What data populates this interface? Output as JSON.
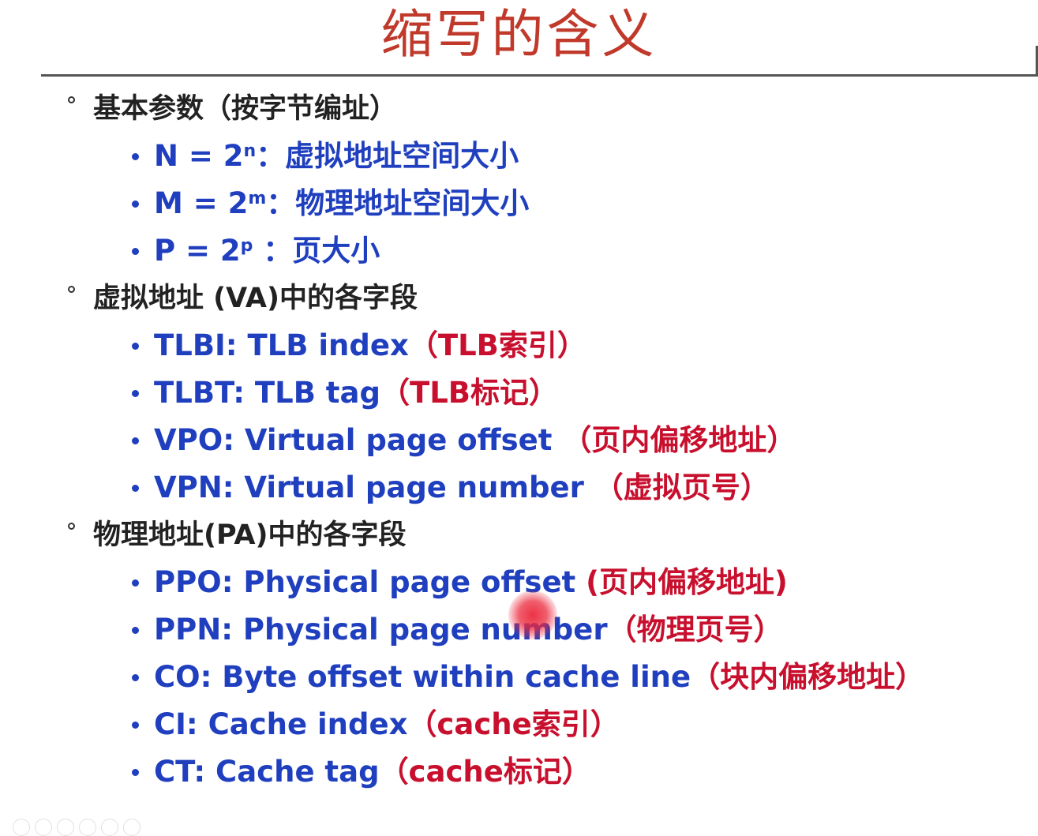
{
  "title": "缩写的含义",
  "sections": [
    {
      "heading": "基本参数（按字节编址）",
      "items": [
        {
          "pre": "N = 2",
          "sup": "n",
          "post": "：虚拟地址空间大小",
          "note": ""
        },
        {
          "pre": "M = 2",
          "sup": "m",
          "post": "：物理地址空间大小",
          "note": ""
        },
        {
          "pre": "P = 2",
          "sup": "p",
          "post": " ：页大小",
          "note": ""
        }
      ]
    },
    {
      "heading": "虚拟地址 (VA)中的各字段",
      "items": [
        {
          "text": "TLBI: TLB index",
          "note": "（TLB索引）"
        },
        {
          "text": "TLBT: TLB tag",
          "note": "（TLB标记）"
        },
        {
          "text": "VPO: Virtual page offset ",
          "note": "（页内偏移地址）"
        },
        {
          "text": "VPN: Virtual page number ",
          "note": "（虚拟页号）"
        }
      ]
    },
    {
      "heading": "物理地址(PA)中的各字段",
      "items": [
        {
          "text": "PPO: Physical page offset ",
          "note": "(页内偏移地址)"
        },
        {
          "text": "PPN: Physical page number",
          "note": "（物理页号）"
        },
        {
          "text": "CO: Byte offset within cache line",
          "note": "（块内偏移地址）"
        },
        {
          "text": "CI: Cache index",
          "note": "（cache索引）"
        },
        {
          "text": "CT: Cache tag",
          "note": "（cache标记）"
        }
      ]
    }
  ],
  "colors": {
    "title": "#c0392b",
    "heading": "#222222",
    "item": "#1f3fbf",
    "note": "#c8102e"
  }
}
